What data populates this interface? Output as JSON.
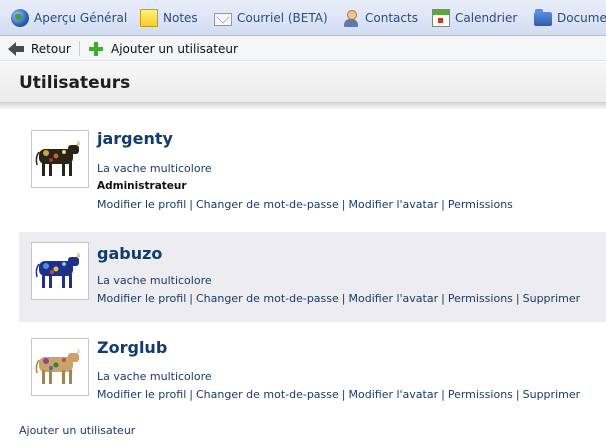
{
  "nav": {
    "items": [
      {
        "label": "Aperçu Général",
        "icon": "globe-icon"
      },
      {
        "label": "Notes",
        "icon": "notes-icon"
      },
      {
        "label": "Courriel (BETA)",
        "icon": "mail-icon"
      },
      {
        "label": "Contacts",
        "icon": "contacts-icon"
      },
      {
        "label": "Calendrier",
        "icon": "calendar-icon"
      },
      {
        "label": "Documents",
        "icon": "documents-icon"
      }
    ]
  },
  "toolbar": {
    "back_label": "Retour",
    "add_user_label": "Ajouter un utilisateur"
  },
  "page": {
    "title": "Utilisateurs"
  },
  "actions": {
    "edit_profile": "Modifier le profil",
    "change_password": "Changer de mot-de-passe",
    "edit_avatar": "Modifier l'avatar",
    "permissions": "Permissions",
    "delete": "Supprimer",
    "separator": "|"
  },
  "users": [
    {
      "name": "jargenty",
      "subtitle": "La vache multicolore",
      "role": "Administrateur",
      "can_delete": false
    },
    {
      "name": "gabuzo",
      "subtitle": "La vache multicolore",
      "role": "",
      "can_delete": true
    },
    {
      "name": "Zorglub",
      "subtitle": "La vache multicolore",
      "role": "",
      "can_delete": true
    }
  ],
  "footer": {
    "add_user_label": "Ajouter un utilisateur"
  },
  "colors": {
    "link": "#1a3a66",
    "username": "#123b6e",
    "selected_row": "#ececf1",
    "nav_background": "#d2dcf2"
  }
}
